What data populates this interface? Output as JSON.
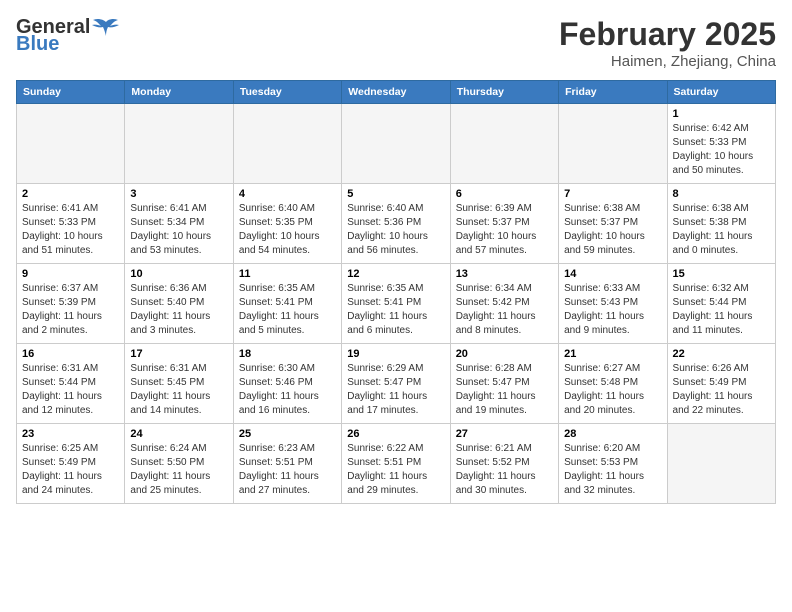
{
  "header": {
    "logo_general": "General",
    "logo_blue": "Blue",
    "month_title": "February 2025",
    "location": "Haimen, Zhejiang, China"
  },
  "days_of_week": [
    "Sunday",
    "Monday",
    "Tuesday",
    "Wednesday",
    "Thursday",
    "Friday",
    "Saturday"
  ],
  "weeks": [
    [
      {
        "day": "",
        "info": ""
      },
      {
        "day": "",
        "info": ""
      },
      {
        "day": "",
        "info": ""
      },
      {
        "day": "",
        "info": ""
      },
      {
        "day": "",
        "info": ""
      },
      {
        "day": "",
        "info": ""
      },
      {
        "day": "1",
        "info": "Sunrise: 6:42 AM\nSunset: 5:33 PM\nDaylight: 10 hours and 50 minutes."
      }
    ],
    [
      {
        "day": "2",
        "info": "Sunrise: 6:41 AM\nSunset: 5:33 PM\nDaylight: 10 hours and 51 minutes."
      },
      {
        "day": "3",
        "info": "Sunrise: 6:41 AM\nSunset: 5:34 PM\nDaylight: 10 hours and 53 minutes."
      },
      {
        "day": "4",
        "info": "Sunrise: 6:40 AM\nSunset: 5:35 PM\nDaylight: 10 hours and 54 minutes."
      },
      {
        "day": "5",
        "info": "Sunrise: 6:40 AM\nSunset: 5:36 PM\nDaylight: 10 hours and 56 minutes."
      },
      {
        "day": "6",
        "info": "Sunrise: 6:39 AM\nSunset: 5:37 PM\nDaylight: 10 hours and 57 minutes."
      },
      {
        "day": "7",
        "info": "Sunrise: 6:38 AM\nSunset: 5:37 PM\nDaylight: 10 hours and 59 minutes."
      },
      {
        "day": "8",
        "info": "Sunrise: 6:38 AM\nSunset: 5:38 PM\nDaylight: 11 hours and 0 minutes."
      }
    ],
    [
      {
        "day": "9",
        "info": "Sunrise: 6:37 AM\nSunset: 5:39 PM\nDaylight: 11 hours and 2 minutes."
      },
      {
        "day": "10",
        "info": "Sunrise: 6:36 AM\nSunset: 5:40 PM\nDaylight: 11 hours and 3 minutes."
      },
      {
        "day": "11",
        "info": "Sunrise: 6:35 AM\nSunset: 5:41 PM\nDaylight: 11 hours and 5 minutes."
      },
      {
        "day": "12",
        "info": "Sunrise: 6:35 AM\nSunset: 5:41 PM\nDaylight: 11 hours and 6 minutes."
      },
      {
        "day": "13",
        "info": "Sunrise: 6:34 AM\nSunset: 5:42 PM\nDaylight: 11 hours and 8 minutes."
      },
      {
        "day": "14",
        "info": "Sunrise: 6:33 AM\nSunset: 5:43 PM\nDaylight: 11 hours and 9 minutes."
      },
      {
        "day": "15",
        "info": "Sunrise: 6:32 AM\nSunset: 5:44 PM\nDaylight: 11 hours and 11 minutes."
      }
    ],
    [
      {
        "day": "16",
        "info": "Sunrise: 6:31 AM\nSunset: 5:44 PM\nDaylight: 11 hours and 12 minutes."
      },
      {
        "day": "17",
        "info": "Sunrise: 6:31 AM\nSunset: 5:45 PM\nDaylight: 11 hours and 14 minutes."
      },
      {
        "day": "18",
        "info": "Sunrise: 6:30 AM\nSunset: 5:46 PM\nDaylight: 11 hours and 16 minutes."
      },
      {
        "day": "19",
        "info": "Sunrise: 6:29 AM\nSunset: 5:47 PM\nDaylight: 11 hours and 17 minutes."
      },
      {
        "day": "20",
        "info": "Sunrise: 6:28 AM\nSunset: 5:47 PM\nDaylight: 11 hours and 19 minutes."
      },
      {
        "day": "21",
        "info": "Sunrise: 6:27 AM\nSunset: 5:48 PM\nDaylight: 11 hours and 20 minutes."
      },
      {
        "day": "22",
        "info": "Sunrise: 6:26 AM\nSunset: 5:49 PM\nDaylight: 11 hours and 22 minutes."
      }
    ],
    [
      {
        "day": "23",
        "info": "Sunrise: 6:25 AM\nSunset: 5:49 PM\nDaylight: 11 hours and 24 minutes."
      },
      {
        "day": "24",
        "info": "Sunrise: 6:24 AM\nSunset: 5:50 PM\nDaylight: 11 hours and 25 minutes."
      },
      {
        "day": "25",
        "info": "Sunrise: 6:23 AM\nSunset: 5:51 PM\nDaylight: 11 hours and 27 minutes."
      },
      {
        "day": "26",
        "info": "Sunrise: 6:22 AM\nSunset: 5:51 PM\nDaylight: 11 hours and 29 minutes."
      },
      {
        "day": "27",
        "info": "Sunrise: 6:21 AM\nSunset: 5:52 PM\nDaylight: 11 hours and 30 minutes."
      },
      {
        "day": "28",
        "info": "Sunrise: 6:20 AM\nSunset: 5:53 PM\nDaylight: 11 hours and 32 minutes."
      },
      {
        "day": "",
        "info": ""
      }
    ]
  ]
}
